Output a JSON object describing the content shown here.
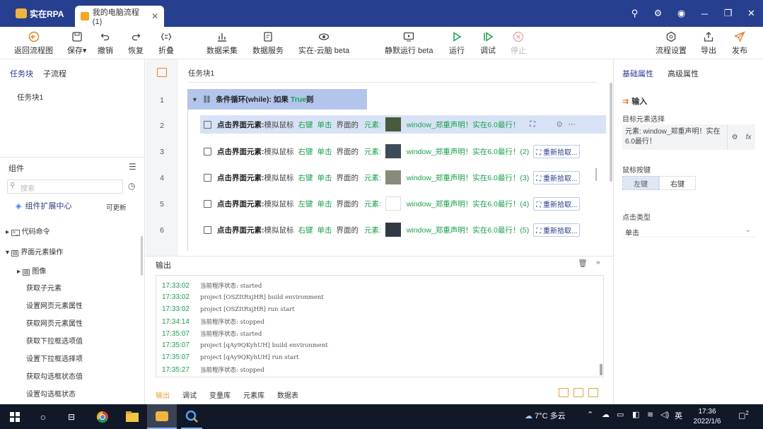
{
  "app": {
    "name": "实在RPA",
    "tab_title": "我的电脑流程(1)",
    "tab_close": "✕"
  },
  "toolbar": {
    "back": "返回流程图",
    "save": "保存",
    "undo": "撤销",
    "redo": "恢复",
    "fold": "折叠",
    "collect": "数据采集",
    "dataservice": "数据服务",
    "cloud": "实在-云脑 beta",
    "silent": "静默运行 beta",
    "run": "运行",
    "debug": "调试",
    "stop": "停止",
    "settings": "流程设置",
    "export": "导出",
    "publish": "发布"
  },
  "left": {
    "tab_task": "任务块",
    "tab_sub": "子流程",
    "add": "+",
    "task1": "任务块1",
    "components": "组件",
    "search_placeholder": "搜索",
    "ext_center": "组件扩展中心",
    "updatable": "可更新",
    "tree": [
      "代码命令",
      "界面元素操作",
      "图像",
      "获取子元素",
      "设置网页元素属性",
      "获取网页元素属性",
      "获取下拉框选项值",
      "设置下拉框选择项",
      "获取勾选框状态值",
      "设置勾选框状态"
    ]
  },
  "canvas": {
    "tab": "任务块1",
    "lines": [
      "1",
      "2",
      "3",
      "4",
      "5",
      "6"
    ],
    "while_label": "条件循环(while): 如果",
    "while_true": "True",
    "while_then": "则",
    "rows": [
      {
        "action": "点击界面元素:",
        "mode": "模拟鼠标",
        "button": "右键",
        "click": "单击",
        "ui": "界面的",
        "elem": "元素:",
        "target": "window_郑重声明！实在6.0最行！",
        "refetch": ""
      },
      {
        "action": "点击界面元素:",
        "mode": "模拟鼠标",
        "button": "右键",
        "click": "单击",
        "ui": "界面的",
        "elem": "元素:",
        "target": "window_郑重声明！实在6.0最行！(2)",
        "refetch": "重新拾取..."
      },
      {
        "action": "点击界面元素:",
        "mode": "模拟鼠标",
        "button": "右键",
        "click": "单击",
        "ui": "界面的",
        "elem": "元素:",
        "target": "window_郑重声明！实在6.0最行！(3)",
        "refetch": "重新拾取..."
      },
      {
        "action": "点击界面元素:",
        "mode": "模拟鼠标",
        "button": "左键",
        "click": "单击",
        "ui": "界面的",
        "elem": "元素:",
        "target": "window_郑重声明！实在6.0最行！(4)",
        "refetch": "重新拾取..."
      },
      {
        "action": "点击界面元素:",
        "mode": "模拟鼠标",
        "button": "右键",
        "click": "单击",
        "ui": "界面的",
        "elem": "元素:",
        "target": "window_郑重声明！实在6.0最行！(5)",
        "refetch": "重新拾取..."
      }
    ]
  },
  "output": {
    "title": "输出",
    "log": [
      {
        "time": "17:33:02",
        "msg": "当前程序状态: started"
      },
      {
        "time": "17:33:02",
        "msg": "project [OSZItRxjHR] build environment"
      },
      {
        "time": "17:33:02",
        "msg": "project [OSZItRxjHR] run start"
      },
      {
        "time": "17:34:14",
        "msg": "当前程序状态: stopped"
      },
      {
        "time": "17:35:07",
        "msg": "当前程序状态: started"
      },
      {
        "time": "17:35:07",
        "msg": "project [qAy9QKyhUH] build environment"
      },
      {
        "time": "17:35:07",
        "msg": "project [qAy9QKyhUH] run start"
      },
      {
        "time": "17:35:27",
        "msg": "当前程序状态: stopped"
      }
    ],
    "tabs": [
      "输出",
      "调试",
      "变量库",
      "元素库",
      "数据表"
    ]
  },
  "right": {
    "tab_basic": "基础属性",
    "tab_adv": "高级属性",
    "input": "输入",
    "target_label": "目标元素选择",
    "target_value": "元素: window_郑重声明！实在6.0最行！",
    "fx": "fx",
    "mouse_label": "鼠标按键",
    "left_btn": "左键",
    "right_btn": "右键",
    "click_label": "点击类型",
    "click_value": "单击"
  },
  "taskbar": {
    "weather": "7°C 多云",
    "ime": "英",
    "time": "17:36",
    "date": "2022/1/6",
    "notif": "2"
  },
  "colors": {
    "titlebar": "#273f8f",
    "accent": "#2b3a8f",
    "green": "#1aa34a",
    "orange": "#e6a23c",
    "selected": "#d8e2f6"
  }
}
